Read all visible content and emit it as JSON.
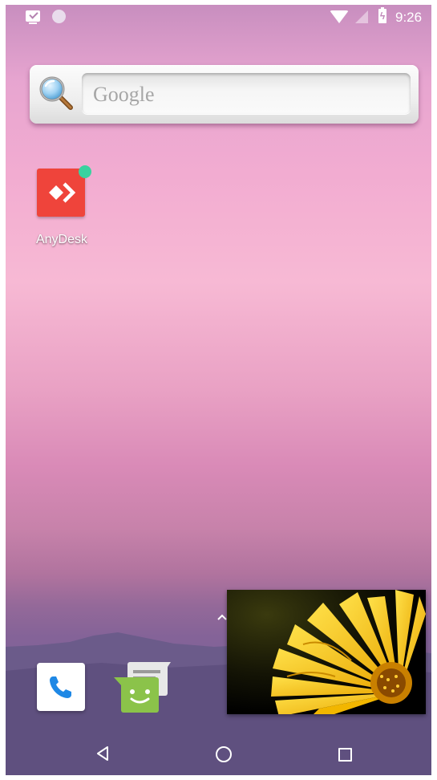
{
  "status_bar": {
    "time": "9:26",
    "icons": [
      "screenshot-notification-icon",
      "sync-notification-icon",
      "wifi-icon",
      "no-signal-icon",
      "battery-charging-icon"
    ]
  },
  "search_widget": {
    "placeholder": "Google",
    "icon": "magnifier-icon"
  },
  "home_apps": [
    {
      "label": "AnyDesk",
      "icon": "anydesk-icon",
      "has_notification_dot": true,
      "accent": "#ef443b",
      "dot_color": "#3ad29f"
    }
  ],
  "dock": [
    {
      "name": "phone",
      "icon": "phone-icon",
      "accent": "#1e88e5"
    },
    {
      "name": "messenger",
      "icon": "messenger-icon",
      "accent": "#8bc34a"
    }
  ],
  "app_drawer_handle": "chevron-up-icon",
  "pip": {
    "content": "picture-in-picture-window",
    "accent": "#f5c518"
  },
  "navigation": {
    "buttons": [
      "back",
      "home",
      "recents"
    ]
  }
}
